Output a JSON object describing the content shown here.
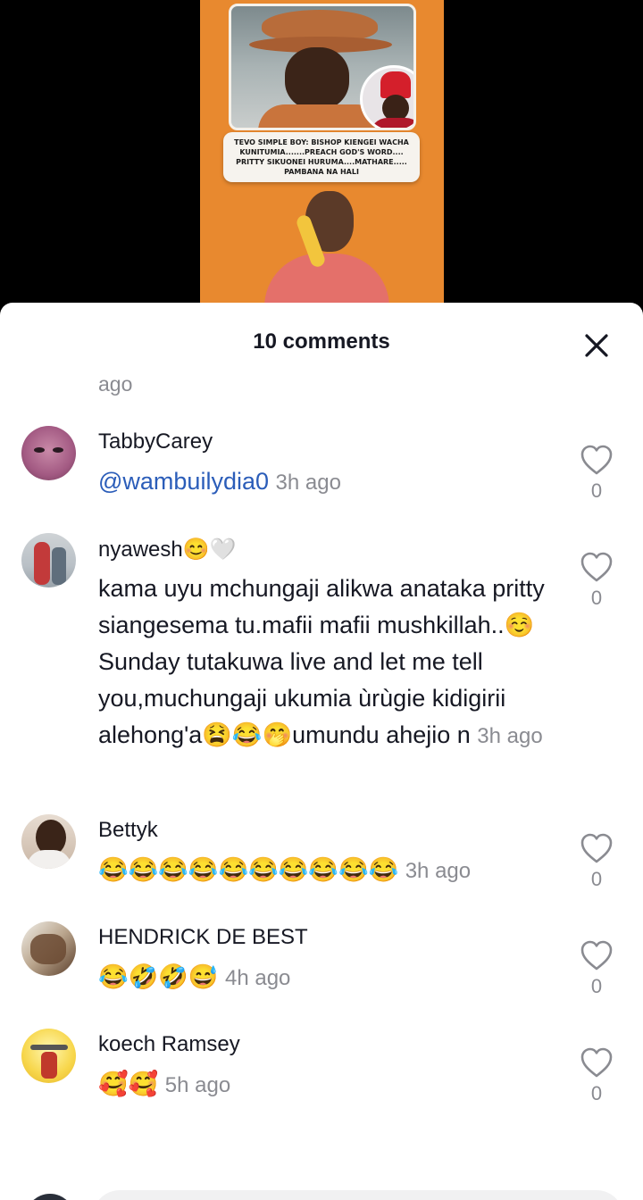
{
  "video": {
    "headline": "TEVO SIMPLE BOY: BISHOP KIENGEI WACHA KUNITUMIA.......PREACH GOD'S WORD.... PRITTY SIKUONEI HURUMA....MATHARE..... PAMBANA NA HALI"
  },
  "sheet": {
    "title": "10 comments",
    "close_icon": "close-icon",
    "partial_line": "ago"
  },
  "comments": [
    {
      "user": "TabbyCarey",
      "mention": "@wambuilydia0",
      "text": "",
      "time": "3h ago",
      "likes": "0"
    },
    {
      "user": "nyawesh😊🤍",
      "mention": "",
      "text": "kama uyu mchungaji alikwa anataka pritty siangesema tu.mafii mafii mushkillah..☺️Sunday tutakuwa live and let me tell you,muchungaji ukumia ùrùgie kidigirii alehong'a😫😂🤭umundu ahejio n",
      "time": "3h ago",
      "likes": "0"
    },
    {
      "user": "Bettyk",
      "mention": "",
      "text": "😂😂😂😂😂😂😂😂😂😂",
      "time": "3h ago",
      "likes": "0"
    },
    {
      "user": "HENDRICK DE BEST",
      "mention": "",
      "text": "😂🤣🤣😅",
      "time": "4h ago",
      "likes": "0"
    },
    {
      "user": "koech Ramsey",
      "mention": "",
      "text": "🥰🥰",
      "time": "5h ago",
      "likes": "0"
    }
  ],
  "colors": {
    "mention": "#2b5db9",
    "muted": "#8a8b91",
    "text": "#161823",
    "video_bg": "#e8892f"
  }
}
